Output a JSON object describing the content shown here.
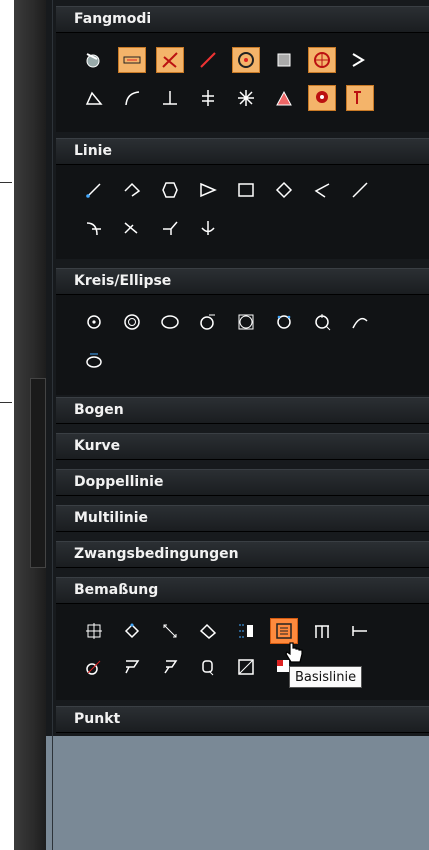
{
  "sections": {
    "fangmodi": {
      "label": "Fangmodi"
    },
    "linie": {
      "label": "Linie"
    },
    "kreis": {
      "label": "Kreis/Ellipse"
    },
    "bogen": {
      "label": "Bogen"
    },
    "kurve": {
      "label": "Kurve"
    },
    "doppellinie": {
      "label": "Doppellinie"
    },
    "multilinie": {
      "label": "Multilinie"
    },
    "zwang": {
      "label": "Zwangsbedingungen"
    },
    "bemassung": {
      "label": "Bemaßung"
    },
    "punkt": {
      "label": "Punkt"
    }
  },
  "tooltip": {
    "text": "Basislinie"
  },
  "icons": {
    "fangmodi_row1": [
      "snap-endpoint-icon",
      "snap-midpoint-icon",
      "snap-intersection-icon",
      "snap-line-icon",
      "snap-center-icon",
      "snap-box-icon",
      "snap-target-icon",
      "snap-arrow-icon"
    ],
    "fangmodi_row2": [
      "snap-angle-icon",
      "snap-curve-icon",
      "snap-perpendicular-icon",
      "snap-tangent-icon",
      "snap-star-icon",
      "snap-vertex-icon",
      "snap-node-icon",
      "snap-text-icon"
    ],
    "linie_row1": [
      "line-icon",
      "polyline-icon",
      "polygon-icon",
      "triangle-icon",
      "rectangle-icon",
      "diamond-icon",
      "angle-line-icon",
      "slope-line-icon"
    ],
    "linie_row2": [
      "bisector-icon",
      "trim-line-icon",
      "branch-line-icon",
      "anchor-line-icon"
    ],
    "kreis_row1": [
      "circle-center-icon",
      "concentric-circle-icon",
      "ellipse-icon",
      "circle-tangent-icon",
      "inscribed-circle-icon",
      "circle-3pt-icon",
      "circle-snap-icon",
      "circle-arc-icon"
    ],
    "kreis_row2": [
      "circle-move-icon"
    ],
    "bemassung_row1": [
      "dim-vertical-icon",
      "dim-aligned-icon",
      "dim-angle-icon",
      "dim-radius-icon",
      "dim-text-icon",
      "dim-baseline-icon",
      "dim-chain-icon",
      "dim-extend-icon"
    ],
    "bemassung_row2": [
      "dim-diameter-icon",
      "dim-leader-icon",
      "dim-leader-2-icon",
      "dim-quick-icon",
      "dim-box-icon",
      "dim-mark-icon"
    ]
  }
}
